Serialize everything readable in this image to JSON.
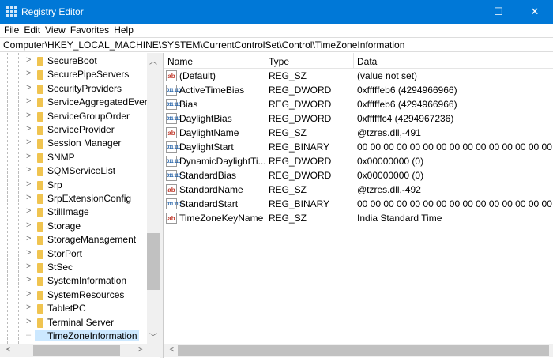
{
  "window": {
    "title": "Registry Editor",
    "minimize": "–",
    "maximize": "☐",
    "close": "✕"
  },
  "menu": [
    "File",
    "Edit",
    "View",
    "Favorites",
    "Help"
  ],
  "address": "Computer\\HKEY_LOCAL_MACHINE\\SYSTEM\\CurrentControlSet\\Control\\TimeZoneInformation",
  "tree": [
    {
      "label": "SecureBoot"
    },
    {
      "label": "SecurePipeServers"
    },
    {
      "label": "SecurityProviders"
    },
    {
      "label": "ServiceAggregatedEvents"
    },
    {
      "label": "ServiceGroupOrder"
    },
    {
      "label": "ServiceProvider"
    },
    {
      "label": "Session Manager"
    },
    {
      "label": "SNMP"
    },
    {
      "label": "SQMServiceList"
    },
    {
      "label": "Srp"
    },
    {
      "label": "SrpExtensionConfig"
    },
    {
      "label": "StillImage"
    },
    {
      "label": "Storage"
    },
    {
      "label": "StorageManagement"
    },
    {
      "label": "StorPort"
    },
    {
      "label": "StSec"
    },
    {
      "label": "SystemInformation"
    },
    {
      "label": "SystemResources"
    },
    {
      "label": "TabletPC"
    },
    {
      "label": "Terminal Server"
    },
    {
      "label": "TimeZoneInformation",
      "selected": true,
      "no_expander": true
    }
  ],
  "columns": {
    "name": "Name",
    "type": "Type",
    "data": "Data"
  },
  "values": [
    {
      "name": "(Default)",
      "type": "REG_SZ",
      "data": "(value not set)",
      "icon": "string-value-icon"
    },
    {
      "name": "ActiveTimeBias",
      "type": "REG_DWORD",
      "data": "0xfffffeb6 (4294966966)",
      "icon": "binary-value-icon"
    },
    {
      "name": "Bias",
      "type": "REG_DWORD",
      "data": "0xfffffeb6 (4294966966)",
      "icon": "binary-value-icon"
    },
    {
      "name": "DaylightBias",
      "type": "REG_DWORD",
      "data": "0xffffffc4 (4294967236)",
      "icon": "binary-value-icon"
    },
    {
      "name": "DaylightName",
      "type": "REG_SZ",
      "data": "@tzres.dll,-491",
      "icon": "string-value-icon"
    },
    {
      "name": "DaylightStart",
      "type": "REG_BINARY",
      "data": "00 00 00 00 00 00 00 00 00 00 00 00 00 00 00 00",
      "icon": "binary-value-icon"
    },
    {
      "name": "DynamicDaylightTi...",
      "type": "REG_DWORD",
      "data": "0x00000000 (0)",
      "icon": "binary-value-icon"
    },
    {
      "name": "StandardBias",
      "type": "REG_DWORD",
      "data": "0x00000000 (0)",
      "icon": "binary-value-icon"
    },
    {
      "name": "StandardName",
      "type": "REG_SZ",
      "data": "@tzres.dll,-492",
      "icon": "string-value-icon"
    },
    {
      "name": "StandardStart",
      "type": "REG_BINARY",
      "data": "00 00 00 00 00 00 00 00 00 00 00 00 00 00 00 00",
      "icon": "binary-value-icon"
    },
    {
      "name": "TimeZoneKeyName",
      "type": "REG_SZ",
      "data": "India Standard Time",
      "icon": "string-value-icon"
    }
  ],
  "icons": {
    "sz": "ab",
    "bin": "011 110"
  }
}
